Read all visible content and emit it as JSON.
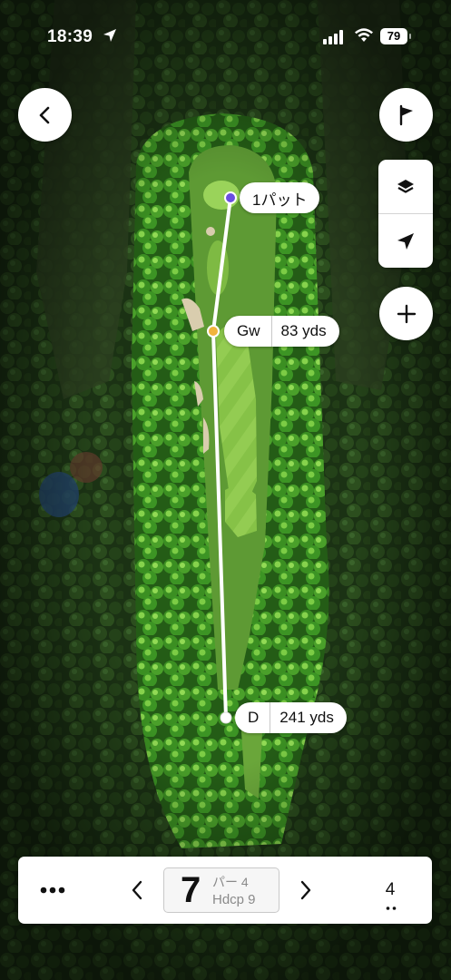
{
  "status_bar": {
    "time": "18:39",
    "battery": "79"
  },
  "map": {
    "shots": [
      {
        "club": "1パット",
        "distance": "",
        "dot_color": "#6a4fe0"
      },
      {
        "club": "Gw",
        "distance": "83 yds",
        "dot_color": "#f1b43c"
      },
      {
        "club": "D",
        "distance": "241 yds",
        "dot_color": "#ffffff"
      }
    ]
  },
  "controls": {
    "back_icon": "chevron-left-icon",
    "flag_icon": "flag-icon",
    "layers_icon": "layers-icon",
    "locate_icon": "navigation-arrow-icon",
    "zoom_icon": "plus-icon"
  },
  "bottom_bar": {
    "more_icon": "ellipsis-icon",
    "hole_number": "7",
    "par": "パー 4",
    "handicap": "Hdcp 9",
    "score": "4"
  }
}
